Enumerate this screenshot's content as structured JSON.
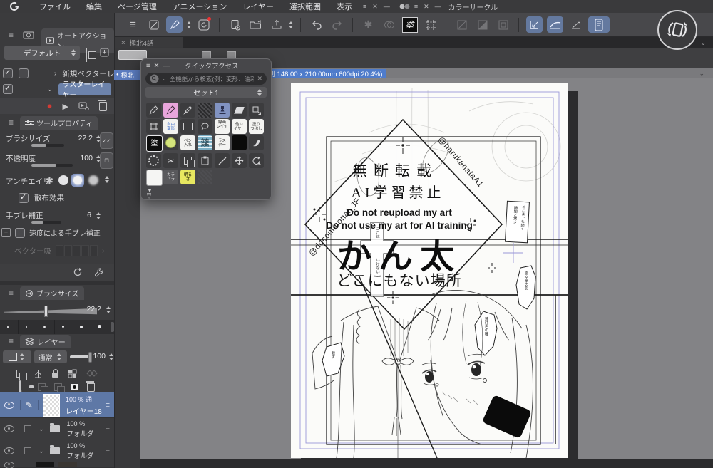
{
  "glyphs": {
    "menu": "≡",
    "close": "✕",
    "minimize": "—",
    "chev_down": "⌄",
    "chev_right": "›",
    "bullet": "●",
    "multiply": "×",
    "play": "▶",
    "record": "●",
    "scissors": "✂",
    "tri_down": "▼",
    "tri_down_open": "▽",
    "star": "✱",
    "slash": "/",
    "handle": "≡",
    "pen": "✎"
  },
  "menu_bar": {
    "items": [
      "ファイル",
      "編集",
      "ページ管理",
      "アニメーション",
      "レイヤー",
      "選択範囲",
      "表示"
    ],
    "palette2_label": "カラーサークル"
  },
  "toolbar": {
    "fill_kanji": "塗"
  },
  "tab_bar": {
    "active": "極北4話"
  },
  "page_panel": {
    "item": "極北"
  },
  "info_bar": {
    "text": "ズ:A5 判 148.00 x 210.00mm 600dpi 20.4%)"
  },
  "quick_access": {
    "title": "クイックアクセス",
    "search_placeholder": "全機能から検索(例：変形、油彩ブラシ)",
    "set": "セット1",
    "cells": {
      "jiyu": "自由\n変形",
      "senga": "線画\nレイヤー",
      "hoka": "他レ\nイヤー",
      "nuri": "塗り\nつぶし",
      "fill": "塗",
      "pen_ire": "ペン\n入れ",
      "hanten": "左右\n反転",
      "raster": "ラス\nター",
      "karabara": "カラ\nバラ",
      "akarusa": "明る\nさ"
    }
  },
  "auto_action": {
    "tab": "オートアクション",
    "preset": "デフォルト",
    "row1": "新規ベクターレ",
    "row2": "ラスターレイヤー"
  },
  "tool_property": {
    "tab": "ツールプロパティ",
    "brush_size_label": "ブラシサイズ",
    "brush_size": "22.2",
    "opacity_label": "不透明度",
    "opacity": "100",
    "aa_label": "アンチエイリ",
    "scatter": "散布効果",
    "stab_label": "手ブレ補正",
    "stab": "6",
    "speed": "速度による手ブレ補正",
    "vector": "ベクター吸"
  },
  "brush_panel": {
    "tab": "ブラシサイズ",
    "value": "22.2"
  },
  "layer_panel": {
    "tab": "レイヤー",
    "blend": "通常",
    "opacity": "100",
    "row1_pct": "100 % 通",
    "row1_name": "レイヤー18",
    "row2_pct": "100 %",
    "row2_name": "フォルダ",
    "row3_pct": "100 %",
    "row3_name": "フォルダ"
  },
  "canvas": {
    "credit_left": "@doconimonai_JF",
    "credit_right": "@harukanataA1",
    "notice1": "無断転載",
    "notice2": "AI学習禁止",
    "en1": "Do not reupload my art",
    "en2": "Do not use my art for AI training",
    "title": "かん太",
    "subtitle": "どこにもない場所",
    "cross_top": "ここは",
    "cross_bottom": "いけない",
    "box1": "どこまでも続く",
    "box2": "暗闇と寒さ",
    "bubble_a": "夜空家の影",
    "bubble_b": "薄紅色の瞳",
    "bubble_c": "殺す"
  }
}
